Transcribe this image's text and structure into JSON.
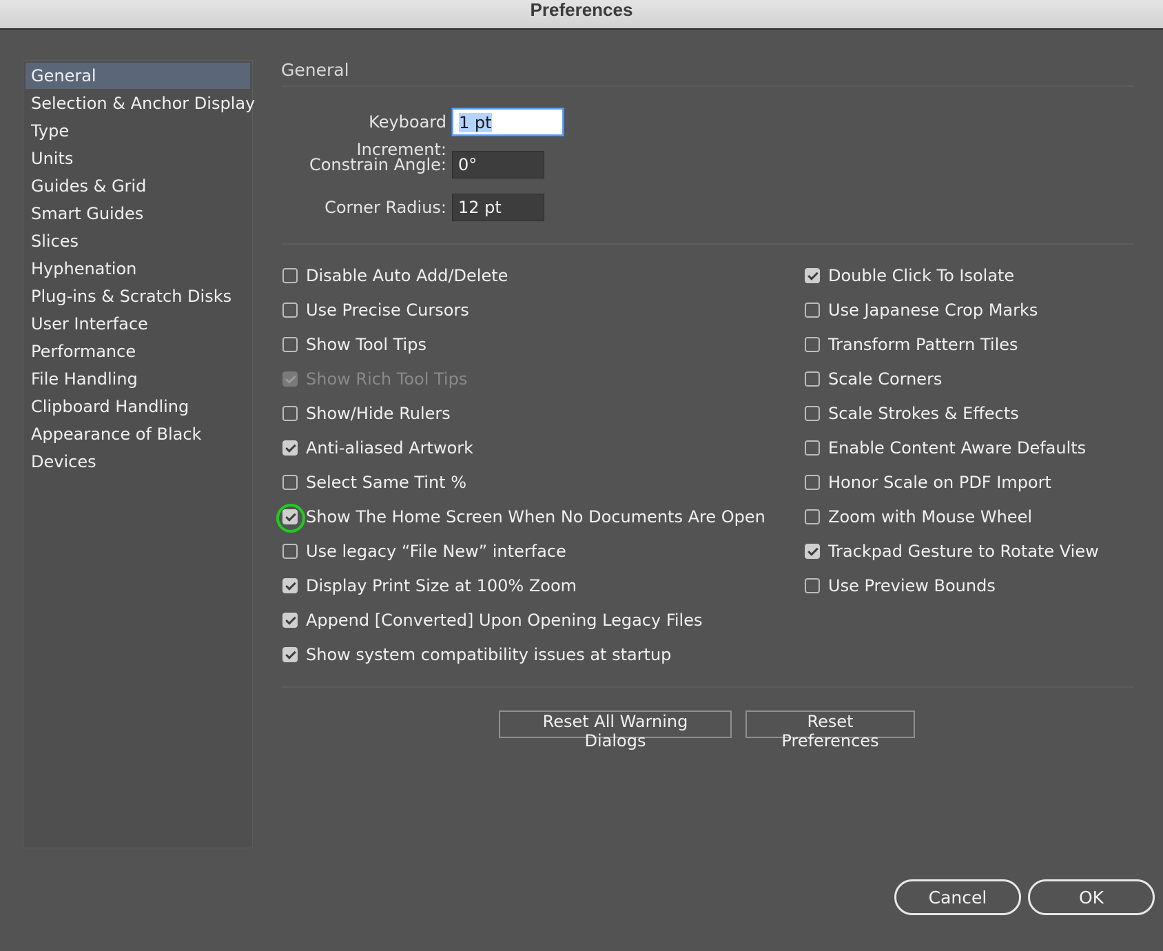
{
  "window": {
    "title": "Preferences"
  },
  "sidebar": {
    "items": [
      {
        "label": "General",
        "selected": true
      },
      {
        "label": "Selection & Anchor Display"
      },
      {
        "label": "Type"
      },
      {
        "label": "Units"
      },
      {
        "label": "Guides & Grid"
      },
      {
        "label": "Smart Guides"
      },
      {
        "label": "Slices"
      },
      {
        "label": "Hyphenation"
      },
      {
        "label": "Plug-ins & Scratch Disks"
      },
      {
        "label": "User Interface"
      },
      {
        "label": "Performance"
      },
      {
        "label": "File Handling"
      },
      {
        "label": "Clipboard Handling"
      },
      {
        "label": "Appearance of Black"
      },
      {
        "label": "Devices"
      }
    ]
  },
  "general": {
    "section_title": "General",
    "keyboard_increment": {
      "label": "Keyboard Increment:",
      "value": "1 pt"
    },
    "constrain_angle": {
      "label": "Constrain Angle:",
      "value": "0°"
    },
    "corner_radius": {
      "label": "Corner Radius:",
      "value": "12 pt"
    },
    "left_options": [
      {
        "label": "Disable Auto Add/Delete",
        "checked": false
      },
      {
        "label": "Use Precise Cursors",
        "checked": false
      },
      {
        "label": "Show Tool Tips",
        "checked": false
      },
      {
        "label": "Show Rich Tool Tips",
        "checked": true,
        "disabled": true
      },
      {
        "label": "Show/Hide Rulers",
        "checked": false
      },
      {
        "label": "Anti-aliased Artwork",
        "checked": true
      },
      {
        "label": "Select Same Tint %",
        "checked": false
      },
      {
        "label": "Show The Home Screen When No Documents Are Open",
        "checked": true,
        "highlighted": true
      },
      {
        "label": "Use legacy “File New” interface",
        "checked": false
      },
      {
        "label": "Display Print Size at 100% Zoom",
        "checked": true
      },
      {
        "label": "Append [Converted] Upon Opening Legacy Files",
        "checked": true
      },
      {
        "label": "Show system compatibility issues at startup",
        "checked": true
      }
    ],
    "right_options": [
      {
        "label": "Double Click To Isolate",
        "checked": true
      },
      {
        "label": "Use Japanese Crop Marks",
        "checked": false
      },
      {
        "label": "Transform Pattern Tiles",
        "checked": false
      },
      {
        "label": "Scale Corners",
        "checked": false
      },
      {
        "label": "Scale Strokes & Effects",
        "checked": false
      },
      {
        "label": "Enable Content Aware Defaults",
        "checked": false
      },
      {
        "label": "Honor Scale on PDF Import",
        "checked": false
      },
      {
        "label": "Zoom with Mouse Wheel",
        "checked": false
      },
      {
        "label": "Trackpad Gesture to Rotate View",
        "checked": true
      },
      {
        "label": "Use Preview Bounds",
        "checked": false
      }
    ],
    "reset_warnings_label": "Reset All Warning Dialogs",
    "reset_preferences_label": "Reset Preferences"
  },
  "footer": {
    "cancel_label": "Cancel",
    "ok_label": "OK"
  },
  "colors": {
    "background": "#535353",
    "selection": "#5b6679",
    "highlight_ring": "#1fcc1f"
  }
}
